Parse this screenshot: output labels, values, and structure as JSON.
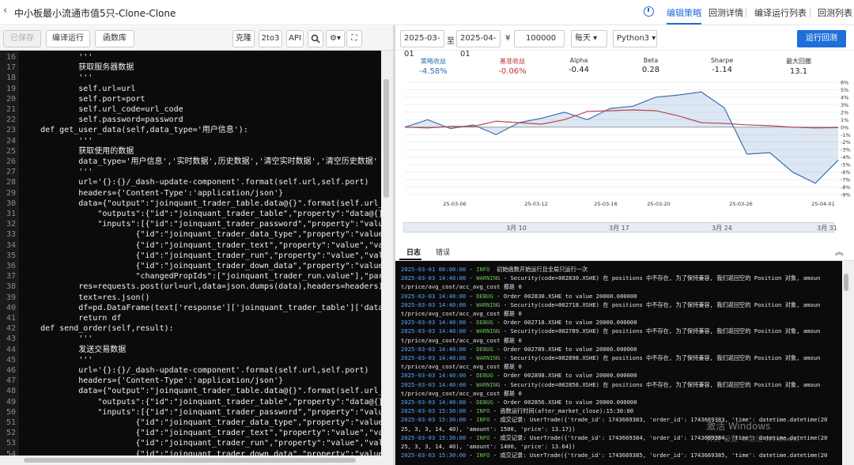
{
  "header": {
    "title": "中小板最小流通市值5只-Clone-Clone",
    "tabs": [
      "编辑策略",
      "回测详情",
      "编译运行列表",
      "回测列表"
    ]
  },
  "toolbar": {
    "save": "已保存",
    "compile": "编译运行",
    "functions": "函数库",
    "clone": "克隆",
    "convert": "2to3",
    "api": "API"
  },
  "code_lines": [
    {
      "n": "16",
      "t": "            '''"
    },
    {
      "n": "17",
      "t": "            获取服务器数据"
    },
    {
      "n": "18",
      "t": "            '''"
    },
    {
      "n": "19",
      "t": "            self.url=url"
    },
    {
      "n": "20",
      "t": "            self.port=port"
    },
    {
      "n": "21",
      "t": "            self.url_code=url_code"
    },
    {
      "n": "22",
      "t": "            self.password=password"
    },
    {
      "n": "23",
      "t": "    def get_user_data(self,data_type='用户信息'):"
    },
    {
      "n": "24",
      "t": "            '''"
    },
    {
      "n": "25",
      "t": "            获取使用的数据"
    },
    {
      "n": "26",
      "t": "            data_type='用户信息','实时数据',历史数据','清空实时数据','清空历史数据'"
    },
    {
      "n": "27",
      "t": "            '''"
    },
    {
      "n": "28",
      "t": "            url='{}:{}/_dash-update-component'.format(self.url,self.port)"
    },
    {
      "n": "29",
      "t": "            headers={'Content-Type':'application/json'}"
    },
    {
      "n": "30",
      "t": "            data={\"output\":\"joinquant_trader_table.data@{}\".format(self.url_code),"
    },
    {
      "n": "31",
      "t": "                \"outputs\":{\"id\":\"joinquant_trader_table\",\"property\":\"data@{}\".format(s"
    },
    {
      "n": "32",
      "t": "                \"inputs\":[{\"id\":\"joinquant_trader_password\",\"property\":\"value\",\"value\""
    },
    {
      "n": "33",
      "t": "                        {\"id\":\"joinquant_trader_data_type\",\"property\":\"value\",\"value\":"
    },
    {
      "n": "34",
      "t": "                        {\"id\":\"joinquant_trader_text\",\"property\":\"value\",\"value\":\"\\n"
    },
    {
      "n": "35",
      "t": "                        {\"id\":\"joinquant_trader_run\",\"property\":\"value\",\"value\":\"运行\""
    },
    {
      "n": "36",
      "t": "                        {\"id\":\"joinquant_trader_down_data\",\"property\":\"value\",\"value\":"
    },
    {
      "n": "37",
      "t": "                        \"changedPropIds\":[\"joinquant_trader_run.value\"],\"parsedChanged"
    },
    {
      "n": "38",
      "t": "            res=requests.post(url=url,data=json.dumps(data),headers=headers)"
    },
    {
      "n": "39",
      "t": "            text=res.json()"
    },
    {
      "n": "40",
      "t": "            df=pd.DataFrame(text['response']['joinquant_trader_table']['data'])"
    },
    {
      "n": "41",
      "t": "            return df"
    },
    {
      "n": "42",
      "t": "    def send_order(self,result):"
    },
    {
      "n": "43",
      "t": "            '''"
    },
    {
      "n": "44",
      "t": "            发送交易数据"
    },
    {
      "n": "45",
      "t": "            '''"
    },
    {
      "n": "46",
      "t": "            url='{}:{}/_dash-update-component'.format(self.url,self.port)"
    },
    {
      "n": "47",
      "t": "            headers={'Content-Type':'application/json'}"
    },
    {
      "n": "48",
      "t": "            data={\"output\":\"joinquant_trader_table.data@{}\".format(self.url_code),"
    },
    {
      "n": "49",
      "t": "                \"outputs\":{\"id\":\"joinquant_trader_table\",\"property\":\"data@{}\".format(s"
    },
    {
      "n": "50",
      "t": "                \"inputs\":[{\"id\":\"joinquant_trader_password\",\"property\":\"value\",\"value\""
    },
    {
      "n": "51",
      "t": "                        {\"id\":\"joinquant_trader_data_type\",\"property\":\"value\",\"value\":"
    },
    {
      "n": "52",
      "t": "                        {\"id\":\"joinquant_trader_text\",\"property\":\"value\",\"value\":resul"
    },
    {
      "n": "53",
      "t": "                        {\"id\":\"joinquant_trader_run\",\"property\":\"value\",\"value\":\"运行\""
    },
    {
      "n": "54",
      "t": "                        {\"id\":\"joinquant_trader_down_data\",\"property\":\"value\",\"value\":"
    }
  ],
  "backtest": {
    "start": "2025-03-01",
    "to": "至",
    "end": "2025-04-01",
    "currency": "¥",
    "capital": "100000",
    "freq": "每天",
    "python": "Python3",
    "run": "运行回测"
  },
  "stats": [
    {
      "label": "策略收益",
      "value": "-4.58%",
      "color": "#2f6fb0"
    },
    {
      "label": "基准收益",
      "value": "-0.06%",
      "color": "#c0392b"
    },
    {
      "label": "Alpha",
      "value": "-0.44",
      "color": "#222"
    },
    {
      "label": "Beta",
      "value": "0.28",
      "color": "#222"
    },
    {
      "label": "Sharpe",
      "value": "-1.14",
      "color": "#222"
    },
    {
      "label": "最大回撤",
      "value": "13.1",
      "color": "#222"
    }
  ],
  "chart_data": {
    "type": "line",
    "ylim": [
      -9,
      6
    ],
    "yticks": [
      "6%",
      "5%",
      "4%",
      "3%",
      "2%",
      "1%",
      "0%",
      "-1%",
      "-2%",
      "-3%",
      "-4%",
      "-5%",
      "-6%",
      "-7%",
      "-8%",
      "-9%"
    ],
    "x_dates": [
      "25-03-06",
      "25-03-12",
      "25-03-16",
      "25-03-20",
      "25-03-26",
      "25-04-01"
    ],
    "series": [
      {
        "name": "策略收益",
        "color": "#3d6fa8",
        "values": [
          0,
          1,
          -0.2,
          0.3,
          -1,
          0.6,
          1.2,
          2,
          1,
          2.5,
          2.8,
          4,
          4.3,
          4.7,
          2.6,
          -3.6,
          -3.4,
          -6,
          -7.5,
          -4.4
        ]
      },
      {
        "name": "基准收益",
        "color": "#b34a4a",
        "values": [
          0,
          -0.1,
          0.1,
          0.1,
          0.8,
          0.6,
          0.4,
          1,
          2.1,
          2.2,
          2.3,
          2.2,
          1.5,
          0.6,
          0.5,
          0.3,
          0.2,
          0,
          -0.1,
          -0.06
        ]
      }
    ],
    "slider_labels": [
      "3月 10",
      "3月 17",
      "3月 24",
      "3月 31"
    ]
  },
  "log_tabs": [
    "日志",
    "错误"
  ],
  "log_lines": [
    {
      "ts": "2025-03-01 00:00:00",
      "lv": "INFO",
      "c": "#6bbf59",
      "msg": "  初始函数开始运行且全局只运行一次"
    },
    {
      "ts": "2025-03-03 14:40:00",
      "lv": "WARNING",
      "c": "#6bbf59",
      "msg": " - Security(code=002830.XSHE) 在 positions 中不存在, 为了保持兼容, 我们返回空的 Position 对象, amoun"
    },
    {
      "ts": "",
      "lv": "",
      "c": "",
      "msg": "t/price/avg_cost/acc_avg_cost 都是 0"
    },
    {
      "ts": "2025-03-03 14:40:00",
      "lv": "DEBUG",
      "c": "#6bbf59",
      "msg": " - Order 002830.XSHE to value 20000.000000"
    },
    {
      "ts": "2025-03-03 14:40:00",
      "lv": "WARNING",
      "c": "#6bbf59",
      "msg": " - Security(code=002718.XSHE) 在 positions 中不存在, 为了保持兼容, 我们返回空的 Position 对象, amoun"
    },
    {
      "ts": "",
      "lv": "",
      "c": "",
      "msg": "t/price/avg_cost/acc_avg_cost 都是 0"
    },
    {
      "ts": "2025-03-03 14:40:00",
      "lv": "DEBUG",
      "c": "#6bbf59",
      "msg": " - Order 002718.XSHE to value 20000.000000"
    },
    {
      "ts": "2025-03-03 14:40:00",
      "lv": "WARNING",
      "c": "#6bbf59",
      "msg": " - Security(code=002789.XSHE) 在 positions 中不存在, 为了保持兼容, 我们返回空的 Position 对象, amoun"
    },
    {
      "ts": "",
      "lv": "",
      "c": "",
      "msg": "t/price/avg_cost/acc_avg_cost 都是 0"
    },
    {
      "ts": "2025-03-03 14:40:00",
      "lv": "DEBUG",
      "c": "#6bbf59",
      "msg": " - Order 002789.XSHE to value 20000.000000"
    },
    {
      "ts": "2025-03-03 14:40:00",
      "lv": "WARNING",
      "c": "#6bbf59",
      "msg": " - Security(code=002898.XSHE) 在 positions 中不存在, 为了保持兼容, 我们返回空的 Position 对象, amoun"
    },
    {
      "ts": "",
      "lv": "",
      "c": "",
      "msg": "t/price/avg_cost/acc_avg_cost 都是 0"
    },
    {
      "ts": "2025-03-03 14:40:00",
      "lv": "DEBUG",
      "c": "#6bbf59",
      "msg": " - Order 002898.XSHE to value 20000.000000"
    },
    {
      "ts": "2025-03-03 14:40:00",
      "lv": "WARNING",
      "c": "#6bbf59",
      "msg": " - Security(code=002856.XSHE) 在 positions 中不存在, 为了保持兼容, 我们返回空的 Position 对象, amoun"
    },
    {
      "ts": "",
      "lv": "",
      "c": "",
      "msg": "t/price/avg_cost/acc_avg_cost 都是 0"
    },
    {
      "ts": "2025-03-03 14:40:00",
      "lv": "DEBUG",
      "c": "#6bbf59",
      "msg": " - Order 002856.XSHE to value 20000.000000"
    },
    {
      "ts": "2025-03-03 15:30:00",
      "lv": "INFO",
      "c": "#6bbf59",
      "msg": " - 函数运行时间(after_market_close):15:30:00"
    },
    {
      "ts": "2025-03-03 15:30:00",
      "lv": "INFO",
      "c": "#6bbf59",
      "msg": " - 成交记录: UserTrade({'trade_id': 1743669383, 'order_id': 1743669383, 'time': datetime.datetime(20"
    },
    {
      "ts": "",
      "lv": "",
      "c": "",
      "msg": "25, 3, 3, 14, 40), 'amount': 1500, 'price': 13.17})"
    },
    {
      "ts": "2025-03-03 15:30:00",
      "lv": "INFO",
      "c": "#6bbf59",
      "msg": " - 成交记录: UserTrade({'trade_id': 1743669384, 'order_id': 1743669384, 'time': datetime.datetime(20"
    },
    {
      "ts": "",
      "lv": "",
      "c": "",
      "msg": "25, 3, 3, 14, 40), 'amount': 1400, 'price': 13.64})"
    },
    {
      "ts": "2025-03-03 15:30:00",
      "lv": "INFO",
      "c": "#6bbf59",
      "msg": " - 成交记录: UserTrade({'trade_id': 1743669385, 'order_id': 1743669385, 'time': datetime.datetime(20"
    }
  ],
  "watermark": {
    "line1": "激活 Windows",
    "line2": "转到\"设置\"以激活 Windows。"
  }
}
